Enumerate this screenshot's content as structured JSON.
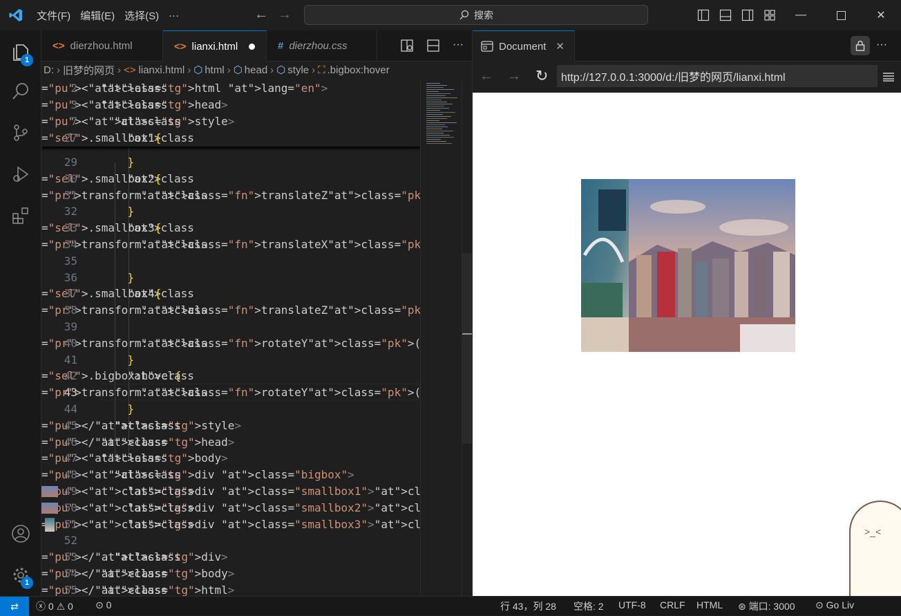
{
  "menu": [
    "文件(F)",
    "编辑(E)",
    "选择(S)",
    "···"
  ],
  "search_label": "搜索",
  "editor_tabs": [
    {
      "label": "dierzhou.html",
      "icon": "html-icon"
    },
    {
      "label": "lianxi.html",
      "icon": "html-icon",
      "modified": true
    },
    {
      "label": "dierzhou.css",
      "icon": "css-icon"
    }
  ],
  "breadcrumb": [
    "D:",
    "旧梦的网页",
    "lianxi.html",
    "html",
    "head",
    "style",
    ".bigbox:hover"
  ],
  "badges": {
    "explorer": "1",
    "settings": "1"
  },
  "sticky": [
    {
      "n": "2",
      "code": "<html lang=\"en\">"
    },
    {
      "n": "3",
      "code": "<head>"
    },
    {
      "n": "7",
      "code": "  <style>"
    },
    {
      "n": "27",
      "code": "    .smallbox1{"
    }
  ],
  "lines": [
    {
      "n": "29",
      "t": "    }"
    },
    {
      "n": "30",
      "t": "    .smallbox2{"
    },
    {
      "n": "31",
      "t": "      transform: translateZ(-100px);"
    },
    {
      "n": "32",
      "t": "    }"
    },
    {
      "n": "33",
      "t": "    .smallbox3{"
    },
    {
      "n": "34",
      "t": "      transform: translateX(-100px) rotateY(-90d"
    },
    {
      "n": "35",
      "t": ""
    },
    {
      "n": "36",
      "t": "    }"
    },
    {
      "n": "37",
      "t": "    .smallbox4{"
    },
    {
      "n": "38",
      "t": "      transform: translateZ(100px);"
    },
    {
      "n": "39",
      "t": ""
    },
    {
      "n": "40",
      "t": "      transform: rotateY(90deg);"
    },
    {
      "n": "41",
      "t": "    }"
    },
    {
      "n": "42",
      "t": "    .bigbox:hover{"
    },
    {
      "n": "43",
      "t": "      transform: rotateY(60deg);"
    },
    {
      "n": "44",
      "t": "    }"
    },
    {
      "n": "45",
      "t": "  </style>"
    },
    {
      "n": "46",
      "t": "</head>"
    },
    {
      "n": "47",
      "t": "<body>"
    },
    {
      "n": "48",
      "t": "  <div class=\"bigbox\">"
    },
    {
      "n": "49",
      "t": "    <div class=\"smallbox1\"><img src=\"./images-ch"
    },
    {
      "n": "50",
      "t": "    <div class=\"smallbox2\"><img src=\"./images-ch"
    },
    {
      "n": "51",
      "t": "    <div class=\"smallbox3\"><img src=\"./images-ch"
    },
    {
      "n": "52",
      "t": ""
    },
    {
      "n": "53",
      "t": "  </div>"
    },
    {
      "n": "54",
      "t": "</body>"
    },
    {
      "n": "55",
      "t": "</html>"
    }
  ],
  "current_line": "43",
  "preview": {
    "tab": "Document",
    "url": "http://127.0.0.1:3000/d:/旧梦的网页/lianxi.html"
  },
  "status": {
    "errors": "0",
    "warnings": "0",
    "ports": "0",
    "cursor": "行 43，列 28",
    "indent": "空格: 2",
    "encoding": "UTF-8",
    "eol": "CRLF",
    "language": "HTML",
    "port": "端口: 3000",
    "golive": "Go Liv"
  },
  "colors": {
    "accent": "#0078d4",
    "background": "#1f1f1f"
  }
}
